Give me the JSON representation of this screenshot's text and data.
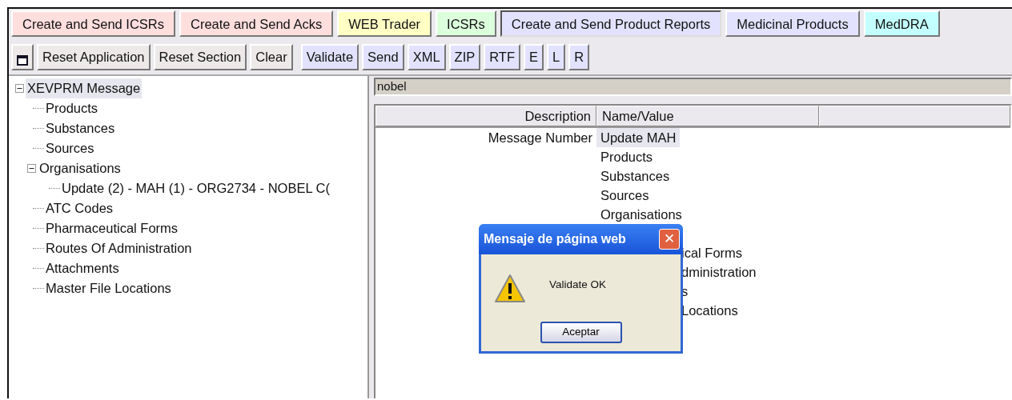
{
  "tabs": [
    {
      "label": "Create and Send ICSRs",
      "color": "#ffdede",
      "selected": false
    },
    {
      "label": "Create and Send Acks",
      "color": "#ffdede",
      "selected": false
    },
    {
      "label": "WEB Trader",
      "color": "#ffffc4",
      "selected": false
    },
    {
      "label": "ICSRs",
      "color": "#dcffdc",
      "selected": false
    },
    {
      "label": "Create and Send Product Reports",
      "color": "#e2e2ff",
      "selected": true
    },
    {
      "label": "Medicinal Products",
      "color": "#e2e2ff",
      "selected": false
    },
    {
      "label": "MedDRA",
      "color": "#c4ffff",
      "selected": false
    }
  ],
  "toolbar": [
    {
      "kind": "icon",
      "color": "#ece9e8"
    },
    {
      "kind": "text",
      "label": "Reset Application",
      "color": "#ece9e8"
    },
    {
      "kind": "text",
      "label": "Reset Section",
      "color": "#ece9e8"
    },
    {
      "kind": "text",
      "label": "Clear",
      "color": "#ece9e8"
    },
    {
      "kind": "text",
      "label": "Validate",
      "color": "#e2e2ff",
      "group_start": true
    },
    {
      "kind": "text",
      "label": "Send",
      "color": "#e2e2ff"
    },
    {
      "kind": "text",
      "label": "XML",
      "color": "#e2e2ff"
    },
    {
      "kind": "text",
      "label": "ZIP",
      "color": "#e2e2ff"
    },
    {
      "kind": "text",
      "label": "RTF",
      "color": "#e2e2ff"
    },
    {
      "kind": "text",
      "label": "E",
      "color": "#e2e2ff"
    },
    {
      "kind": "text",
      "label": "L",
      "color": "#e2e2ff"
    },
    {
      "kind": "text",
      "label": "R",
      "color": "#e2e2ff"
    }
  ],
  "tree": {
    "label": "XEVPRM Message",
    "expanded": true,
    "selected": true,
    "children": [
      {
        "label": "Products",
        "selected": false
      },
      {
        "label": "Substances",
        "selected": false
      },
      {
        "label": "Sources",
        "selected": false
      },
      {
        "label": "Organisations",
        "expanded": true,
        "selected": false,
        "children": [
          {
            "label": "Update (2) - MAH (1) - ORG2734 - NOBEL C(",
            "selected": false
          }
        ]
      },
      {
        "label": "ATC Codes",
        "selected": false
      },
      {
        "label": "Pharmaceutical Forms",
        "selected": false
      },
      {
        "label": "Routes Of Administration",
        "selected": false
      },
      {
        "label": "Attachments",
        "selected": false
      },
      {
        "label": "Master File Locations",
        "selected": false
      }
    ]
  },
  "search_bar": {
    "value": "nobel"
  },
  "detail_table": {
    "columns": [
      "Description",
      "Name/Value"
    ],
    "description": "Message Number",
    "values": [
      {
        "text": "Update MAH",
        "selected": true
      },
      {
        "text": "Products",
        "selected": false
      },
      {
        "text": "Substances",
        "selected": false
      },
      {
        "text": "Sources",
        "selected": false
      },
      {
        "text": "Organisations",
        "selected": false
      }
    ],
    "values_behind_dialog": [
      "ical Forms",
      "dministration",
      "s",
      "Locations"
    ]
  },
  "dialog": {
    "title": "Mensaje de página web",
    "close": "✕",
    "message": "Validate OK",
    "button": "Aceptar"
  }
}
